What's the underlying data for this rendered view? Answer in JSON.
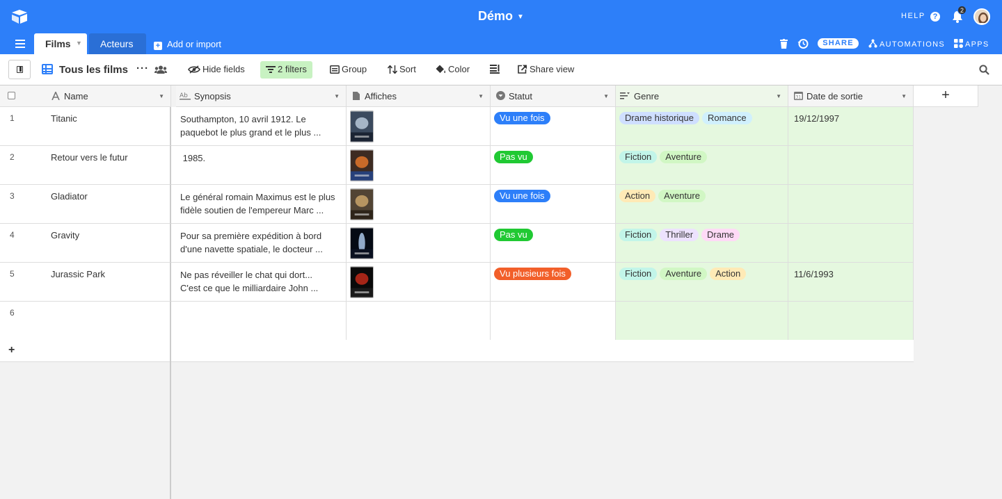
{
  "base": {
    "title": "Démo"
  },
  "topbar": {
    "help": "HELP",
    "help_icon": "?",
    "notifications": "2",
    "share": "SHARE",
    "automations": "AUTOMATIONS",
    "apps": "APPS"
  },
  "tabs": [
    {
      "label": "Films"
    },
    {
      "label": "Acteurs"
    }
  ],
  "add_import": "Add or import",
  "toolbar": {
    "view_name": "Tous les films",
    "hide_fields": "Hide fields",
    "filters": "2 filters",
    "group": "Group",
    "sort": "Sort",
    "color": "Color",
    "share_view": "Share view"
  },
  "columns": [
    {
      "label": "Name",
      "icon": "text-a-icon"
    },
    {
      "label": "Synopsis",
      "icon": "long-text-icon"
    },
    {
      "label": "Affiches",
      "icon": "attachment-icon"
    },
    {
      "label": "Statut",
      "icon": "single-select-icon"
    },
    {
      "label": "Genre",
      "icon": "multi-select-icon"
    },
    {
      "label": "Date de sortie",
      "icon": "calendar-icon"
    }
  ],
  "rows": [
    {
      "num": "1",
      "name": "Titanic",
      "synopsis": "Southampton, 10 avril 1912. Le\npaquebot le plus grand et le plus ...",
      "statut": "Vu une fois",
      "statut_color": "#2d7ff9",
      "genres": [
        "Drame historique",
        "Romance"
      ],
      "date": "19/12/1997"
    },
    {
      "num": "2",
      "name": "Retour vers le futur",
      "synopsis": " 1985.",
      "statut": "Pas vu",
      "statut_color": "#20c933",
      "genres": [
        "Fiction",
        "Aventure"
      ],
      "date": ""
    },
    {
      "num": "3",
      "name": "Gladiator",
      "synopsis": "Le général romain Maximus est le plus\nfidèle soutien de l'empereur Marc ...",
      "statut": "Vu une fois",
      "statut_color": "#2d7ff9",
      "genres": [
        "Action",
        "Aventure"
      ],
      "date": ""
    },
    {
      "num": "4",
      "name": "Gravity",
      "synopsis": "Pour sa première expédition à bord\nd'une navette spatiale, le docteur ...",
      "statut": "Pas vu",
      "statut_color": "#20c933",
      "genres": [
        "Fiction",
        "Thriller",
        "Drame"
      ],
      "date": ""
    },
    {
      "num": "5",
      "name": "Jurassic Park",
      "synopsis": "Ne pas réveiller le chat qui dort...\nC'est ce que le milliardaire John ...",
      "statut": "Vu plusieurs fois",
      "statut_color": "#f25f2a",
      "genres": [
        "Fiction",
        "Aventure",
        "Action"
      ],
      "date": "11/6/1993"
    },
    {
      "num": "6",
      "name": "",
      "synopsis": "",
      "statut": "",
      "statut_color": "",
      "genres": [],
      "date": ""
    }
  ],
  "genre_colors": {
    "Drame historique": "#cfdfff",
    "Romance": "#d0f0fd",
    "Fiction": "#c2f5e9",
    "Aventure": "#d1f7c4",
    "Action": "#ffeab6",
    "Thriller": "#ede2fe",
    "Drame": "#ffdaf6"
  },
  "colors": {
    "brand": "#2d7ff9",
    "filter_bg": "#c8f2c2",
    "genre_bg": "#e5f8df"
  }
}
